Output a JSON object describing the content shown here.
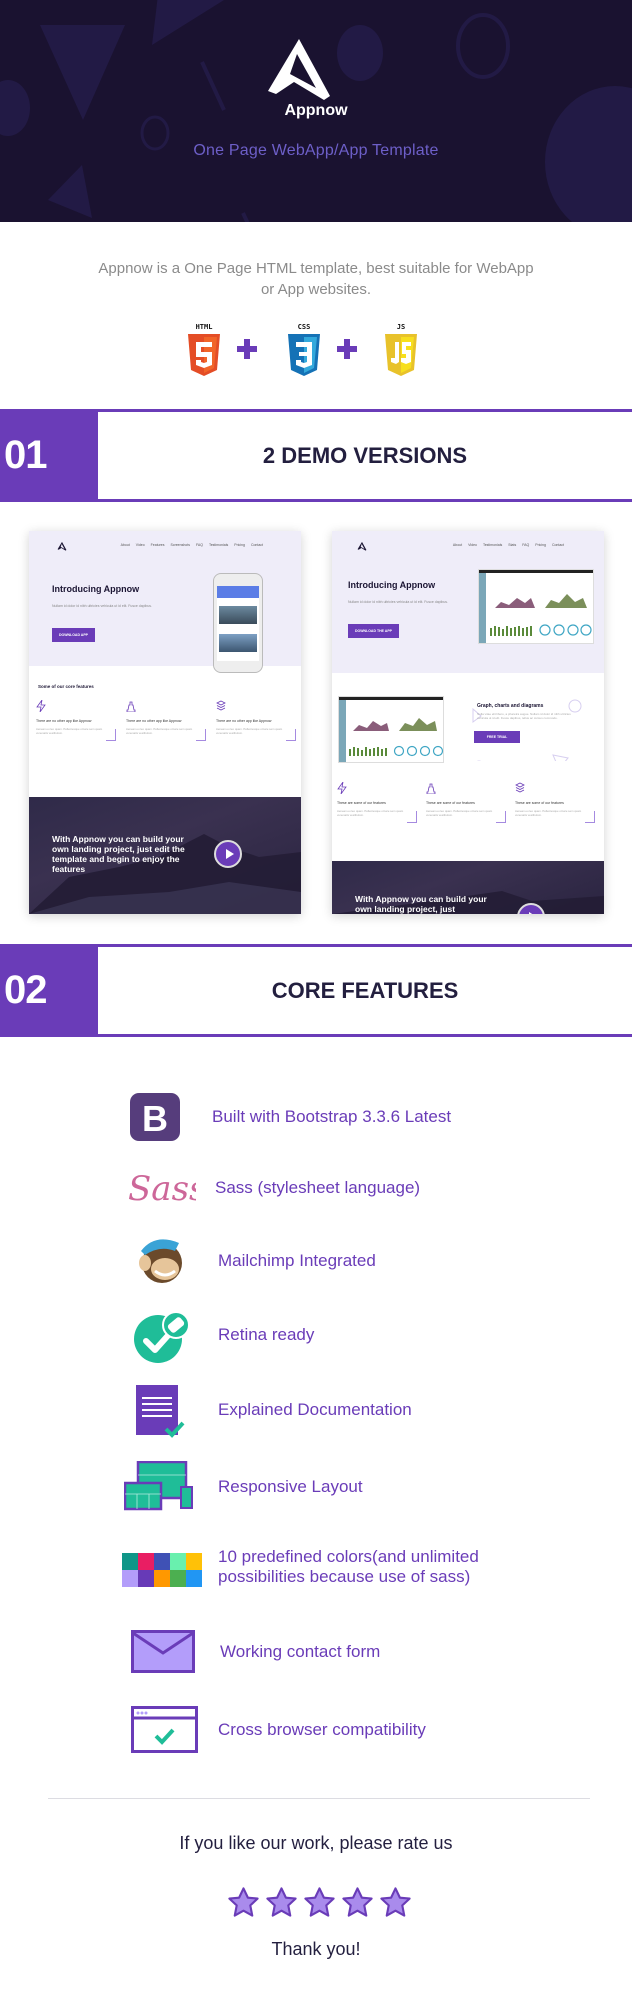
{
  "hero": {
    "brand": "Appnow",
    "tagline": "One Page WebApp/App Template",
    "logo_icon": "appnow-a-logo-icon"
  },
  "intro": {
    "description": "Appnow is a One Page HTML template, best suitable for WebApp or App websites.",
    "technologies": [
      {
        "label": "HTML",
        "glyph": "5",
        "icon": "html5-icon",
        "color": "#e44d26"
      },
      {
        "label": "CSS",
        "glyph": "3",
        "icon": "css3-icon",
        "color": "#1572b6"
      },
      {
        "label": "JS",
        "glyph": "JS",
        "icon": "javascript-icon",
        "color": "#f0db4f"
      }
    ]
  },
  "sections": [
    {
      "number": "01",
      "title": "2 DEMO VERSIONS"
    },
    {
      "number": "02",
      "title": "CORE FEATURES"
    }
  ],
  "demos": [
    {
      "nav": [
        "About",
        "Video",
        "Features",
        "Screenshots",
        "FAQ",
        "Testimonials",
        "Pricing",
        "Contact"
      ],
      "heading": "Introducing Appnow",
      "paragraph": "Nullam id dolor id nibh ultricies vehicula ut id elit. Fusce dapibus.",
      "button": "DOWNLOAD APP",
      "features_title": "Some of our core features",
      "features": [
        {
          "icon": "lightning-icon",
          "title": "There are no other app like Appnow",
          "text": "Aenean eu leo quam. Pellentesque ornare sem quam venenatis vestibulum."
        },
        {
          "icon": "chess-piece-icon",
          "title": "There are no other app like Appnow",
          "text": "Aenean eu leo quam. Pellentesque ornare sem quam venenatis vestibulum."
        },
        {
          "icon": "layers-icon",
          "title": "There are no other app like Appnow",
          "text": "Aenean eu leo quam. Pellentesque ornare sem quam venenatis vestibulum."
        }
      ],
      "cta": "With Appnow you can build your own landing project, just edit the template and begin to enjoy the features"
    },
    {
      "nav": [
        "About",
        "Video",
        "Testimonials",
        "Stats",
        "FAQ",
        "Pricing",
        "Contact"
      ],
      "heading": "Introducing Appnow",
      "paragraph": "Nullam id dolor id nibh ultricies vehicula ut id elit. Fusce dapibus.",
      "button": "DOWNLOAD THE APP",
      "graph_heading": "Graph, charts and diagrams",
      "graph_text": "Nulla vitae elit libero, a pharetra augue. Nullam id dolor id nibh ultricies vehicula ut id elit. Fusce dapibus, tellus ac cursus commodo.",
      "graph_button": "FREE TRIAL",
      "features": [
        {
          "icon": "lightning-icon",
          "title": "These are some of our features",
          "text": "Aenean eu leo quam. Pellentesque ornare sem quam venenatis vestibulum."
        },
        {
          "icon": "chess-piece-icon",
          "title": "These are some of our features",
          "text": "Aenean eu leo quam. Pellentesque ornare sem quam venenatis vestibulum."
        },
        {
          "icon": "layers-icon",
          "title": "These are some of our features",
          "text": "Aenean eu leo quam. Pellentesque ornare sem quam venenatis vestibulum."
        }
      ],
      "cta": "With Appnow you can build your own landing project, just"
    }
  ],
  "core_features": [
    {
      "icon": "bootstrap-icon",
      "label": "Built with Bootstrap 3.3.6 Latest"
    },
    {
      "icon": "sass-icon",
      "label": "Sass (stylesheet language)"
    },
    {
      "icon": "mailchimp-icon",
      "label": "Mailchimp Integrated"
    },
    {
      "icon": "retina-check-icon",
      "label": "Retina ready"
    },
    {
      "icon": "documentation-icon",
      "label": "Explained Documentation"
    },
    {
      "icon": "responsive-devices-icon",
      "label": "Responsive Layout"
    },
    {
      "icon": "color-palette-icon",
      "label": "10 predefined colors(and unlimited possibilities because use of sass)"
    },
    {
      "icon": "envelope-icon",
      "label": "Working contact form"
    },
    {
      "icon": "browser-check-icon",
      "label": "Cross browser compatibility"
    }
  ],
  "palette_colors": [
    "#0f9688",
    "#e91e63",
    "#3f51b5",
    "#69f0ae",
    "#ffc107",
    "#b39dfa",
    "#673ab7",
    "#ff9800",
    "#4caf50",
    "#2196f3"
  ],
  "rating": {
    "prompt": "If you like our work, please rate us",
    "stars": 5,
    "max_stars": 5,
    "thanks": "Thank you!"
  },
  "colors": {
    "accent": "#6a3cb8",
    "hero_bg": "#1a1230",
    "heading": "#231f3f",
    "tagline": "#6d5fc8"
  }
}
